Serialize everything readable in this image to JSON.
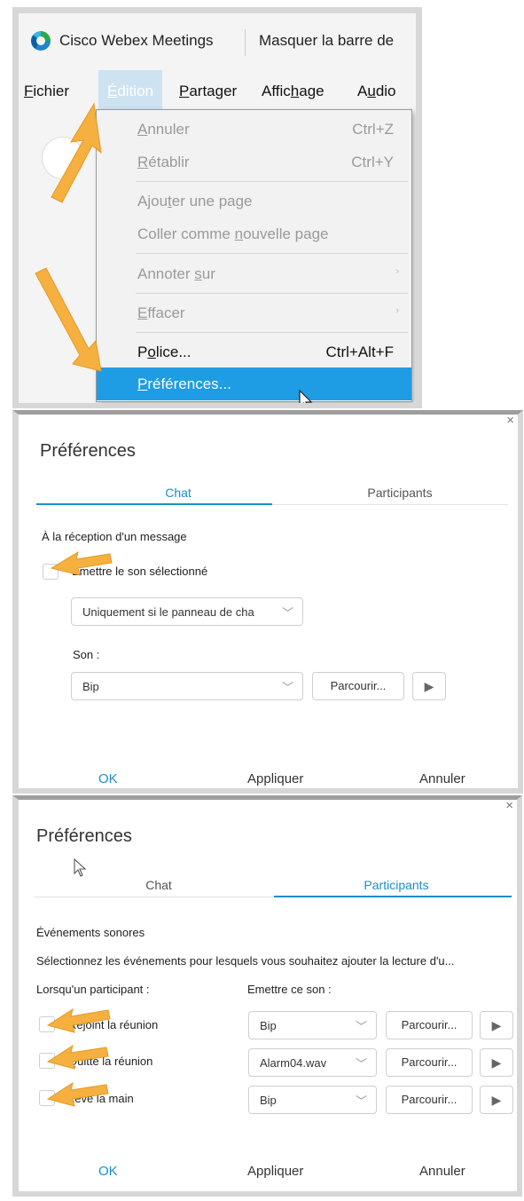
{
  "window": {
    "app_title": "Cisco Webex Meetings",
    "hide_bar": "Masquer la barre de"
  },
  "menubar": [
    {
      "pre": "",
      "u": "F",
      "post": "ichier"
    },
    {
      "pre": "",
      "u": "É",
      "post": "dition"
    },
    {
      "pre": "",
      "u": "P",
      "post": "artager"
    },
    {
      "pre": "Affic",
      "u": "h",
      "post": "age"
    },
    {
      "pre": "A",
      "u": "u",
      "post": "dio"
    }
  ],
  "edit_menu": {
    "items": [
      {
        "pre": "",
        "u": "A",
        "post": "nnuler",
        "shortcut": "Ctrl+Z",
        "state": "disabled"
      },
      {
        "pre": "",
        "u": "R",
        "post": "établir",
        "shortcut": "Ctrl+Y",
        "state": "disabled"
      },
      {
        "pre": "Ajou",
        "u": "t",
        "post": "er une page",
        "shortcut": "",
        "state": "disabled"
      },
      {
        "pre": "Coller comme ",
        "u": "n",
        "post": "ouvelle page",
        "shortcut": "",
        "state": "disabled"
      },
      {
        "pre": "Annoter ",
        "u": "s",
        "post": "ur",
        "shortcut": "",
        "state": "disabled",
        "submenu": "›"
      },
      {
        "pre": "",
        "u": "E",
        "post": "ffacer",
        "shortcut": "",
        "state": "disabled",
        "submenu": "›"
      },
      {
        "pre": "P",
        "u": "o",
        "post": "lice...",
        "shortcut": "Ctrl+Alt+F",
        "state": "enabled"
      },
      {
        "pre": "",
        "u": "P",
        "post": "références...",
        "shortcut": "",
        "state": "highlight"
      }
    ]
  },
  "prefs_chat": {
    "close": "×",
    "title": "Préférences",
    "tabs": [
      "Chat",
      "Participants"
    ],
    "active_tab": 0,
    "section": "À la réception d'un message",
    "checkbox_label": "Emettre le son sélectionné",
    "condition_select": "Uniquement si le panneau de cha",
    "sound_label": "Son :",
    "sound_select": "Bip",
    "browse": "Parcourir...",
    "play": "▶",
    "footer": {
      "ok": "OK",
      "apply": "Appliquer",
      "cancel": "Annuler"
    }
  },
  "prefs_participants": {
    "close": "×",
    "title": "Préférences",
    "tabs": [
      "Chat",
      "Participants"
    ],
    "active_tab": 1,
    "section": "Événements sonores",
    "description": "Sélectionnez les événements pour lesquels vous souhaitez ajouter la lecture d'u...",
    "col_when": "Lorsqu'un participant :",
    "col_sound": "Emettre ce son :",
    "rows": [
      {
        "event": "Rejoint la réunion",
        "sound": "Bip",
        "browse": "Parcourir...",
        "play": "▶"
      },
      {
        "event": "Quitte la réunion",
        "sound": "Alarm04.wav",
        "browse": "Parcourir...",
        "play": "▶"
      },
      {
        "event": "Lève la main",
        "sound": "Bip",
        "browse": "Parcourir...",
        "play": "▶"
      }
    ],
    "footer": {
      "ok": "OK",
      "apply": "Appliquer",
      "cancel": "Annuler"
    }
  },
  "colors": {
    "accent": "#1e9ce4",
    "annotation_arrow": "#f6b040",
    "active_menu_bg": "#cde3f2",
    "tab_active": "#1a8fc9",
    "ok_text": "#1a8fc9"
  },
  "chevron": "﹀"
}
